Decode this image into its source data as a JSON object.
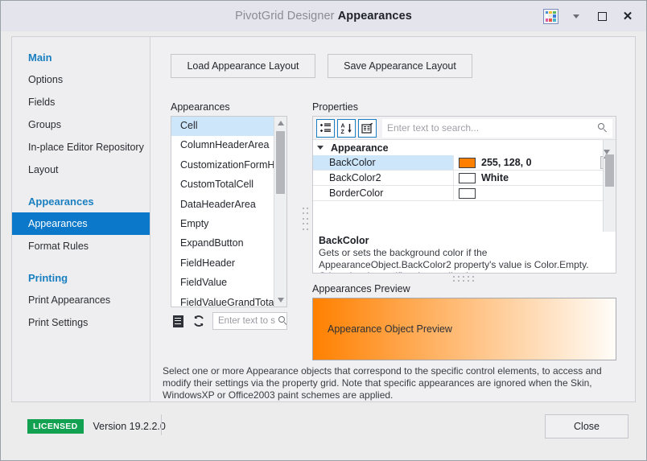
{
  "window": {
    "title_prefix": "PivotGrid Designer",
    "title_main": "Appearances",
    "skin_icon": "skin-palette-icon",
    "dropdown_icon": "chevron-down-icon",
    "maximize_icon": "maximize-icon",
    "close_icon": "close-icon",
    "skin_colors": [
      "#4a90d9",
      "#f2c230",
      "#5bb85b",
      "#ffffff",
      "#e8e8ea",
      "#3b7dd8",
      "#e05aa0",
      "#e8574c",
      "#49b6c8"
    ]
  },
  "sidebar": {
    "groups": [
      {
        "label": "Main",
        "items": [
          {
            "label": "Options",
            "selected": false
          },
          {
            "label": "Fields",
            "selected": false
          },
          {
            "label": "Groups",
            "selected": false
          },
          {
            "label": "In-place Editor Repository",
            "selected": false
          },
          {
            "label": "Layout",
            "selected": false
          }
        ]
      },
      {
        "label": "Appearances",
        "items": [
          {
            "label": "Appearances",
            "selected": true
          },
          {
            "label": "Format Rules",
            "selected": false
          }
        ]
      },
      {
        "label": "Printing",
        "items": [
          {
            "label": "Print Appearances",
            "selected": false
          },
          {
            "label": "Print Settings",
            "selected": false
          }
        ]
      }
    ]
  },
  "toolbar": {
    "load_label": "Load Appearance Layout",
    "save_label": "Save Appearance Layout"
  },
  "appearances_panel": {
    "label": "Appearances",
    "items": [
      {
        "label": "Cell",
        "selected": true
      },
      {
        "label": "ColumnHeaderArea",
        "selected": false
      },
      {
        "label": "CustomizationFormHint",
        "selected": false
      },
      {
        "label": "CustomTotalCell",
        "selected": false
      },
      {
        "label": "DataHeaderArea",
        "selected": false
      },
      {
        "label": "Empty",
        "selected": false
      },
      {
        "label": "ExpandButton",
        "selected": false
      },
      {
        "label": "FieldHeader",
        "selected": false
      },
      {
        "label": "FieldValue",
        "selected": false
      },
      {
        "label": "FieldValueGrandTotal",
        "selected": false
      }
    ],
    "list_toolbar": {
      "menu_icon": "list-menu-icon",
      "refresh_icon": "refresh-icon",
      "search_placeholder": "Enter text to s",
      "search_icon": "search-icon"
    }
  },
  "properties_panel": {
    "label": "Properties",
    "buttons": [
      {
        "name": "categorized-icon",
        "title": "Categorized"
      },
      {
        "name": "alphabetical-sort-icon",
        "title": "Alphabetical"
      },
      {
        "name": "property-pages-icon",
        "title": "Property Pages"
      }
    ],
    "search_placeholder": "Enter text to search...",
    "search_icon": "search-icon",
    "category": "Appearance",
    "rows": [
      {
        "name": "BackColor",
        "value": "255, 128, 0",
        "swatch": "#ff8000",
        "selected": true,
        "has_dropdown": true
      },
      {
        "name": "BackColor2",
        "value": "White",
        "swatch": "#ffffff",
        "selected": false,
        "has_dropdown": false
      },
      {
        "name": "BorderColor",
        "value": "",
        "swatch": "#ffffff",
        "selected": false,
        "has_dropdown": false
      }
    ]
  },
  "description": {
    "title": "BackColor",
    "text": "Gets or sets the background color if the AppearanceObject.BackColor2 property's value is Color.Empty. Otherwise, it specifies the gradient's star…"
  },
  "preview": {
    "label": "Appearances Preview",
    "text": "Appearance Object Preview",
    "gradient_start": "#ff8000",
    "gradient_end": "#fffdf9"
  },
  "hint": "Select one or more Appearance objects that correspond to the specific control elements, to access and modify their settings via the property grid. Note that specific appearances are ignored when the Skin, WindowsXP or Office2003 paint schemes are applied.",
  "statusbar": {
    "license_badge": "LICENSED",
    "version": "Version 19.2.2.0",
    "close_label": "Close"
  }
}
